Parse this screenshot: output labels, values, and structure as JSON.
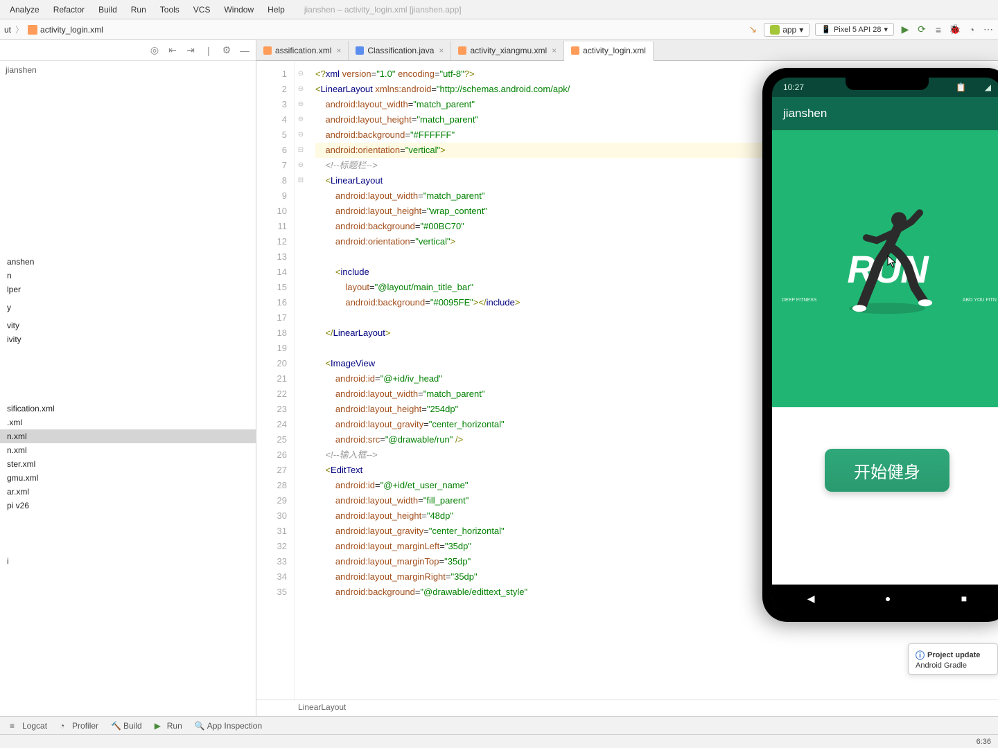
{
  "menubar": {
    "items": [
      "Analyze",
      "Refactor",
      "Build",
      "Run",
      "Tools",
      "VCS",
      "Window",
      "Help"
    ],
    "title_path": "jianshen – activity_login.xml [jianshen.app]"
  },
  "breadcrumb": {
    "segment1": "ut",
    "segment2": "activity_login.xml"
  },
  "run_config": {
    "label": "app"
  },
  "device_config": {
    "label": "Pixel 5 API 28"
  },
  "project": {
    "root": "jianshen",
    "items_top": [
      "anshen",
      "n",
      "lper",
      "",
      "y",
      "",
      "vity",
      "ivity"
    ],
    "items_bottom": [
      "sification.xml",
      ".xml",
      "n.xml",
      "n.xml",
      "ster.xml",
      "gmu.xml",
      "ar.xml",
      "pi v26"
    ],
    "selected_index": 2,
    "footer_item": "i"
  },
  "tabs": [
    {
      "label": "assification.xml",
      "kind": "xml",
      "active": false
    },
    {
      "label": "Classification.java",
      "kind": "java",
      "active": false
    },
    {
      "label": "activity_xiangmu.xml",
      "kind": "xml",
      "active": false
    },
    {
      "label": "activity_login.xml",
      "kind": "xml",
      "active": true
    }
  ],
  "code": {
    "lines": [
      {
        "n": 1,
        "html": "<span class='c-decl'>&lt;?</span><span class='c-tag'>xml</span> <span class='c-attr'>version</span>=<span class='c-val'>\"1.0\"</span> <span class='c-attr'>encoding</span>=<span class='c-val'>\"utf-8\"</span><span class='c-decl'>?&gt;</span>"
      },
      {
        "n": 2,
        "html": "<span class='c-decl'>&lt;</span><span class='c-tag'>LinearLayout</span> <span class='c-attr'>xmlns:android</span>=<span class='c-val'>\"http://schemas.android.com/apk/</span>"
      },
      {
        "n": 3,
        "html": "    <span class='c-attr'>android:layout_width</span>=<span class='c-val'>\"match_parent\"</span>"
      },
      {
        "n": 4,
        "html": "    <span class='c-attr'>android:layout_height</span>=<span class='c-val'>\"match_parent\"</span>"
      },
      {
        "n": 5,
        "html": "    <span class='c-attr'>android:background</span>=<span class='c-val'>\"#FFFFFF\"</span>"
      },
      {
        "n": 6,
        "html": "    <span class='c-attr'>android:orientation</span>=<span class='c-val'>\"vertical\"</span><span class='c-decl'>&gt;</span>",
        "hl": true
      },
      {
        "n": 7,
        "html": "    <span class='c-cmt'>&lt;!--标题栏--&gt;</span>"
      },
      {
        "n": 8,
        "html": "    <span class='c-decl'>&lt;</span><span class='c-tag'>LinearLayout</span>"
      },
      {
        "n": 9,
        "html": "        <span class='c-attr'>android:layout_width</span>=<span class='c-val'>\"match_parent\"</span>"
      },
      {
        "n": 10,
        "html": "        <span class='c-attr'>android:layout_height</span>=<span class='c-val'>\"wrap_content\"</span>"
      },
      {
        "n": 11,
        "html": "        <span class='c-attr'>android:background</span>=<span class='c-val'>\"#00BC70\"</span>"
      },
      {
        "n": 12,
        "html": "        <span class='c-attr'>android:orientation</span>=<span class='c-val'>\"vertical\"</span><span class='c-decl'>&gt;</span>"
      },
      {
        "n": 13,
        "html": ""
      },
      {
        "n": 14,
        "html": "        <span class='c-decl'>&lt;</span><span class='c-tag'>include</span>"
      },
      {
        "n": 15,
        "html": "            <span class='c-attr'>layout</span>=<span class='c-val'>\"@layout/main_title_bar\"</span>"
      },
      {
        "n": 16,
        "html": "            <span class='c-attr'>android:background</span>=<span class='c-val'>\"#0095FE\"</span><span class='c-decl'>&gt;&lt;/</span><span class='c-tag'>include</span><span class='c-decl'>&gt;</span>"
      },
      {
        "n": 17,
        "html": ""
      },
      {
        "n": 18,
        "html": "    <span class='c-decl'>&lt;/</span><span class='c-tag'>LinearLayout</span><span class='c-decl'>&gt;</span>"
      },
      {
        "n": 19,
        "html": ""
      },
      {
        "n": 20,
        "html": "    <span class='c-decl'>&lt;</span><span class='c-tag'>ImageView</span>"
      },
      {
        "n": 21,
        "html": "        <span class='c-attr'>android:id</span>=<span class='c-val'>\"@+id/iv_head\"</span>"
      },
      {
        "n": 22,
        "html": "        <span class='c-attr'>android:layout_width</span>=<span class='c-val'>\"match_parent\"</span>"
      },
      {
        "n": 23,
        "html": "        <span class='c-attr'>android:layout_height</span>=<span class='c-val'>\"254dp\"</span>"
      },
      {
        "n": 24,
        "html": "        <span class='c-attr'>android:layout_gravity</span>=<span class='c-val'>\"center_horizontal\"</span>"
      },
      {
        "n": 25,
        "html": "        <span class='c-attr'>android:src</span>=<span class='c-val'>\"@drawable/run\"</span> <span class='c-decl'>/&gt;</span>"
      },
      {
        "n": 26,
        "html": "    <span class='c-cmt'>&lt;!--输入框--&gt;</span>"
      },
      {
        "n": 27,
        "html": "    <span class='c-decl'>&lt;</span><span class='c-tag'>EditText</span>"
      },
      {
        "n": 28,
        "html": "        <span class='c-attr'>android:id</span>=<span class='c-val'>\"@+id/et_user_name\"</span>"
      },
      {
        "n": 29,
        "html": "        <span class='c-attr'>android:layout_width</span>=<span class='c-val'>\"fill_parent\"</span>"
      },
      {
        "n": 30,
        "html": "        <span class='c-attr'>android:layout_height</span>=<span class='c-val'>\"48dp\"</span>"
      },
      {
        "n": 31,
        "html": "        <span class='c-attr'>android:layout_gravity</span>=<span class='c-val'>\"center_horizontal\"</span>"
      },
      {
        "n": 32,
        "html": "        <span class='c-attr'>android:layout_marginLeft</span>=<span class='c-val'>\"35dp\"</span>"
      },
      {
        "n": 33,
        "html": "        <span class='c-attr'>android:layout_marginTop</span>=<span class='c-val'>\"35dp\"</span>"
      },
      {
        "n": 34,
        "html": "        <span class='c-attr'>android:layout_marginRight</span>=<span class='c-val'>\"35dp\"</span>"
      },
      {
        "n": 35,
        "html": "        <span class='c-attr'>android:background</span>=<span class='c-val'>\"@drawable/edittext_style\"</span>"
      }
    ],
    "breadcrumb": "LinearLayout"
  },
  "emulator": {
    "time": "10:27",
    "app_title": "jianshen",
    "hero_text": "RUN",
    "small_left": "DEEP\nFITNESS",
    "small_right": "ABO\nYOU\nFITN",
    "button_label": "开始健身"
  },
  "bottom_bar": {
    "items": [
      "Logcat",
      "Profiler",
      "Build",
      "Run",
      "App Inspection"
    ]
  },
  "status_bar": {
    "time": "6:36"
  },
  "notification": {
    "title": "Project update",
    "body": "Android Gradle"
  }
}
